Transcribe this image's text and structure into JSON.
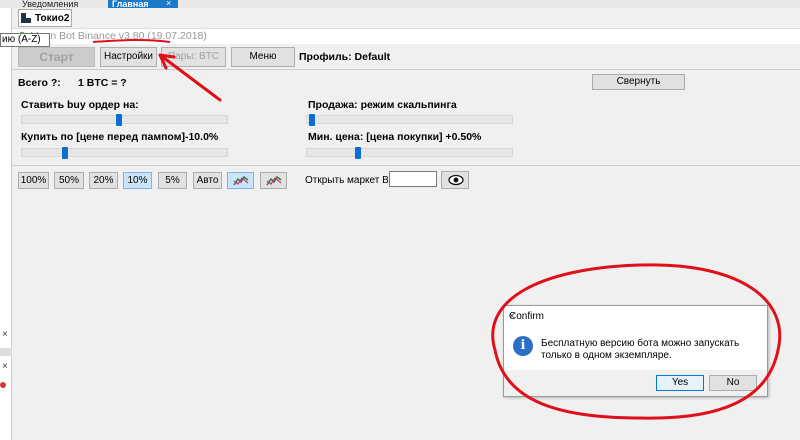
{
  "tabs": [
    {
      "label": "Уведомления"
    },
    {
      "label": "Главная",
      "active": true
    }
  ],
  "tab_close": "×",
  "tooltip": "ию (A-Z)",
  "panel_tab": "Токио2",
  "window_title": "Moon Bot Binance v3.80 (19.07.2018)",
  "toolbar": {
    "start": "Старт",
    "settings": "Настройки",
    "pairs": "Пары: BTC",
    "menu": "Меню",
    "profile": "Профиль: Default"
  },
  "summary": {
    "total": "Всего ?:",
    "rate": "1 BTC = ?",
    "collapse": "Свернуть"
  },
  "settings": {
    "buy_order_label": "Ставить buy ордер на:",
    "buy_price_label": "Купить по [цене перед пампом]-10.0%",
    "sell_label": "Продажа: режим скальпинга",
    "min_price_label": "Мин. цена: [цена покупки] +0.50%",
    "buy_order_slider": 0.47,
    "buy_price_slider": 0.2,
    "sell_slider": 0.01,
    "min_price_slider": 0.24
  },
  "percent_buttons": [
    {
      "label": "100%"
    },
    {
      "label": "50%"
    },
    {
      "label": "20%"
    },
    {
      "label": "10%",
      "selected": true
    },
    {
      "label": "5%"
    },
    {
      "label": "Авто"
    }
  ],
  "open_market_label": "Открыть маркет BTC-",
  "open_market_value": "",
  "dialog": {
    "title": "Confirm",
    "message": "Бесплатную версию бота можно запускать только в одном экземпляре.",
    "yes": "Yes",
    "no": "No",
    "close": "×",
    "info_glyph": "i"
  },
  "left_strip": {
    "x1": "×",
    "x2": "×"
  },
  "colors": {
    "accent": "#1c79c7",
    "annotation": "#e0101a",
    "info": "#2b6fc7"
  }
}
